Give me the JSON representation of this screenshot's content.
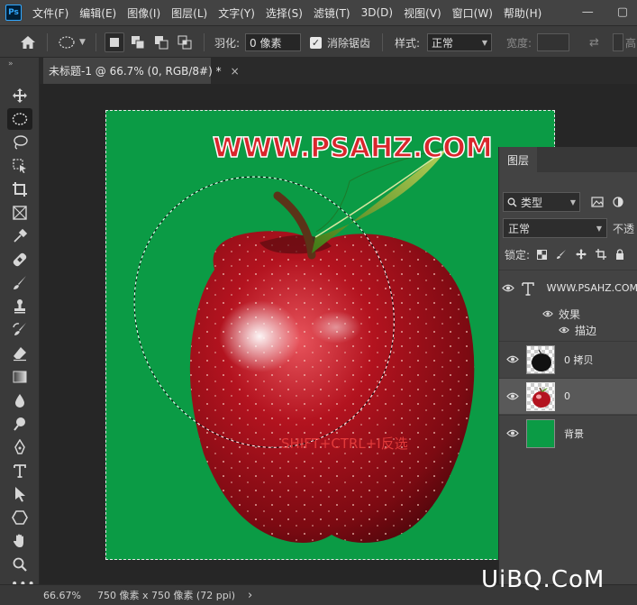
{
  "app": {
    "logo_text": "Ps"
  },
  "menu": [
    "文件(F)",
    "编辑(E)",
    "图像(I)",
    "图层(L)",
    "文字(Y)",
    "选择(S)",
    "滤镜(T)",
    "3D(D)",
    "视图(V)",
    "窗口(W)",
    "帮助(H)"
  ],
  "window_controls": {
    "minimize": "—",
    "maximize": "▢"
  },
  "options": {
    "feather_label": "羽化:",
    "feather_value": "0 像素",
    "antialias_label": "消除锯齿",
    "antialias_checked": true,
    "style_label": "样式:",
    "style_value": "正常",
    "width_label": "宽度:",
    "height_label": "高"
  },
  "document_tab": {
    "title": "未标题-1 @ 66.7% (0, RGB/8#) *",
    "close": "×"
  },
  "canvas": {
    "background_color": "#0b9b45",
    "watermark_text": "WWW.PSAHZ.COM",
    "hint_text": "SHIFT+CTRL+I反选"
  },
  "layers_panel": {
    "tab_label": "图层",
    "filter_kind": "类型",
    "blend_mode": "正常",
    "opacity_label": "不透",
    "lock_label": "锁定:",
    "layers": [
      {
        "name": "WWW.PSAHZ.COM",
        "type": "text",
        "selected": false
      },
      {
        "name": "0 拷贝",
        "type": "image-black-apple",
        "selected": false
      },
      {
        "name": "0",
        "type": "image-red-apple",
        "selected": true
      },
      {
        "name": "背景",
        "type": "fill-green",
        "selected": false
      }
    ],
    "effects_label": "效果",
    "stroke_label": "描边"
  },
  "status": {
    "zoom": "66.67%",
    "doc_info": "750 像素 x 750 像素 (72 ppi)",
    "arrow": "›"
  },
  "site_logo": "UiBQ.CoM",
  "colors": {
    "accent": "#31a8ff",
    "canvas_green": "#0b9b45",
    "watermark_red": "#d9262c",
    "hint_red": "#e23a3a"
  }
}
